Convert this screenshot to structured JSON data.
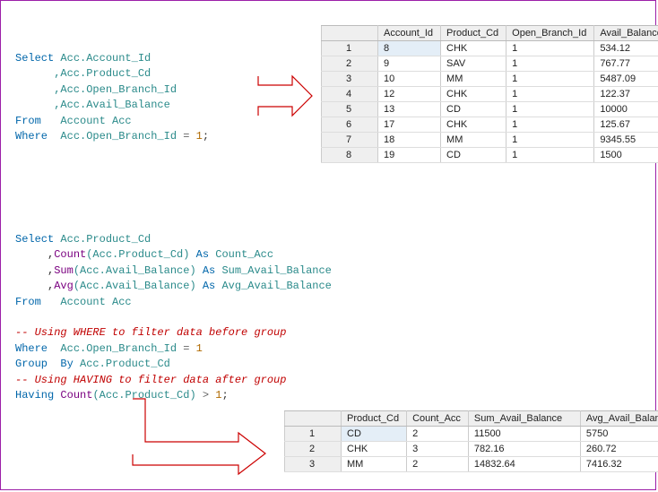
{
  "sql1": {
    "l1": {
      "kw": "Select",
      "c": " Acc.Account_Id"
    },
    "l2": "      ,Acc.Product_Cd",
    "l3": "      ,Acc.Open_Branch_Id",
    "l4": "      ,Acc.Avail_Balance",
    "l5": {
      "kw": "From",
      "c": "   Account Acc"
    },
    "l6": {
      "kw": "Where",
      "c": "  Acc.Open_Branch_Id ",
      "op": "=",
      "num": " 1",
      "end": ";"
    }
  },
  "table1": {
    "headers": [
      "Account_Id",
      "Product_Cd",
      "Open_Branch_Id",
      "Avail_Balance"
    ],
    "rows": [
      {
        "n": "1",
        "c": [
          "8",
          "CHK",
          "1",
          "534.12"
        ]
      },
      {
        "n": "2",
        "c": [
          "9",
          "SAV",
          "1",
          "767.77"
        ]
      },
      {
        "n": "3",
        "c": [
          "10",
          "MM",
          "1",
          "5487.09"
        ]
      },
      {
        "n": "4",
        "c": [
          "12",
          "CHK",
          "1",
          "122.37"
        ]
      },
      {
        "n": "5",
        "c": [
          "13",
          "CD",
          "1",
          "10000"
        ]
      },
      {
        "n": "6",
        "c": [
          "17",
          "CHK",
          "1",
          "125.67"
        ]
      },
      {
        "n": "7",
        "c": [
          "18",
          "MM",
          "1",
          "9345.55"
        ]
      },
      {
        "n": "8",
        "c": [
          "19",
          "CD",
          "1",
          "1500"
        ]
      }
    ]
  },
  "sql2": {
    "l1": {
      "kw": "Select",
      "c": " Acc.Product_Cd"
    },
    "l2": {
      "p1": "     ,",
      "fn": "Count",
      "args": "(Acc.Product_Cd)",
      "kw2": " As",
      "alias": " Count_Acc"
    },
    "l3": {
      "p1": "     ,",
      "fn": "Sum",
      "args": "(Acc.Avail_Balance)",
      "kw2": " As",
      "alias": " Sum_Avail_Balance"
    },
    "l4": {
      "p1": "     ,",
      "fn": "Avg",
      "args": "(Acc.Avail_Balance)",
      "kw2": " As",
      "alias": " Avg_Avail_Balance"
    },
    "l5": {
      "kw": "From",
      "c": "   Account Acc"
    },
    "c1": "-- Using WHERE to filter data before group",
    "l6": {
      "kw": "Where",
      "c": "  Acc.Open_Branch_Id ",
      "op": "=",
      "num": " 1"
    },
    "l7": {
      "kw1": "Group",
      "kw2": "  By",
      "c": " Acc.Product_Cd"
    },
    "c2": "-- Using HAVING to filter data after group",
    "l8": {
      "kw": "Having",
      "fn": " Count",
      "args": "(Acc.Product_Cd) ",
      "op": ">",
      "num": " 1",
      "end": ";"
    }
  },
  "table2": {
    "headers": [
      "Product_Cd",
      "Count_Acc",
      "Sum_Avail_Balance",
      "Avg_Avail_Balance"
    ],
    "rows": [
      {
        "n": "1",
        "c": [
          "CD",
          "2",
          "11500",
          "5750"
        ]
      },
      {
        "n": "2",
        "c": [
          "CHK",
          "3",
          "782.16",
          "260.72"
        ]
      },
      {
        "n": "3",
        "c": [
          "MM",
          "2",
          "14832.64",
          "7416.32"
        ]
      }
    ]
  }
}
